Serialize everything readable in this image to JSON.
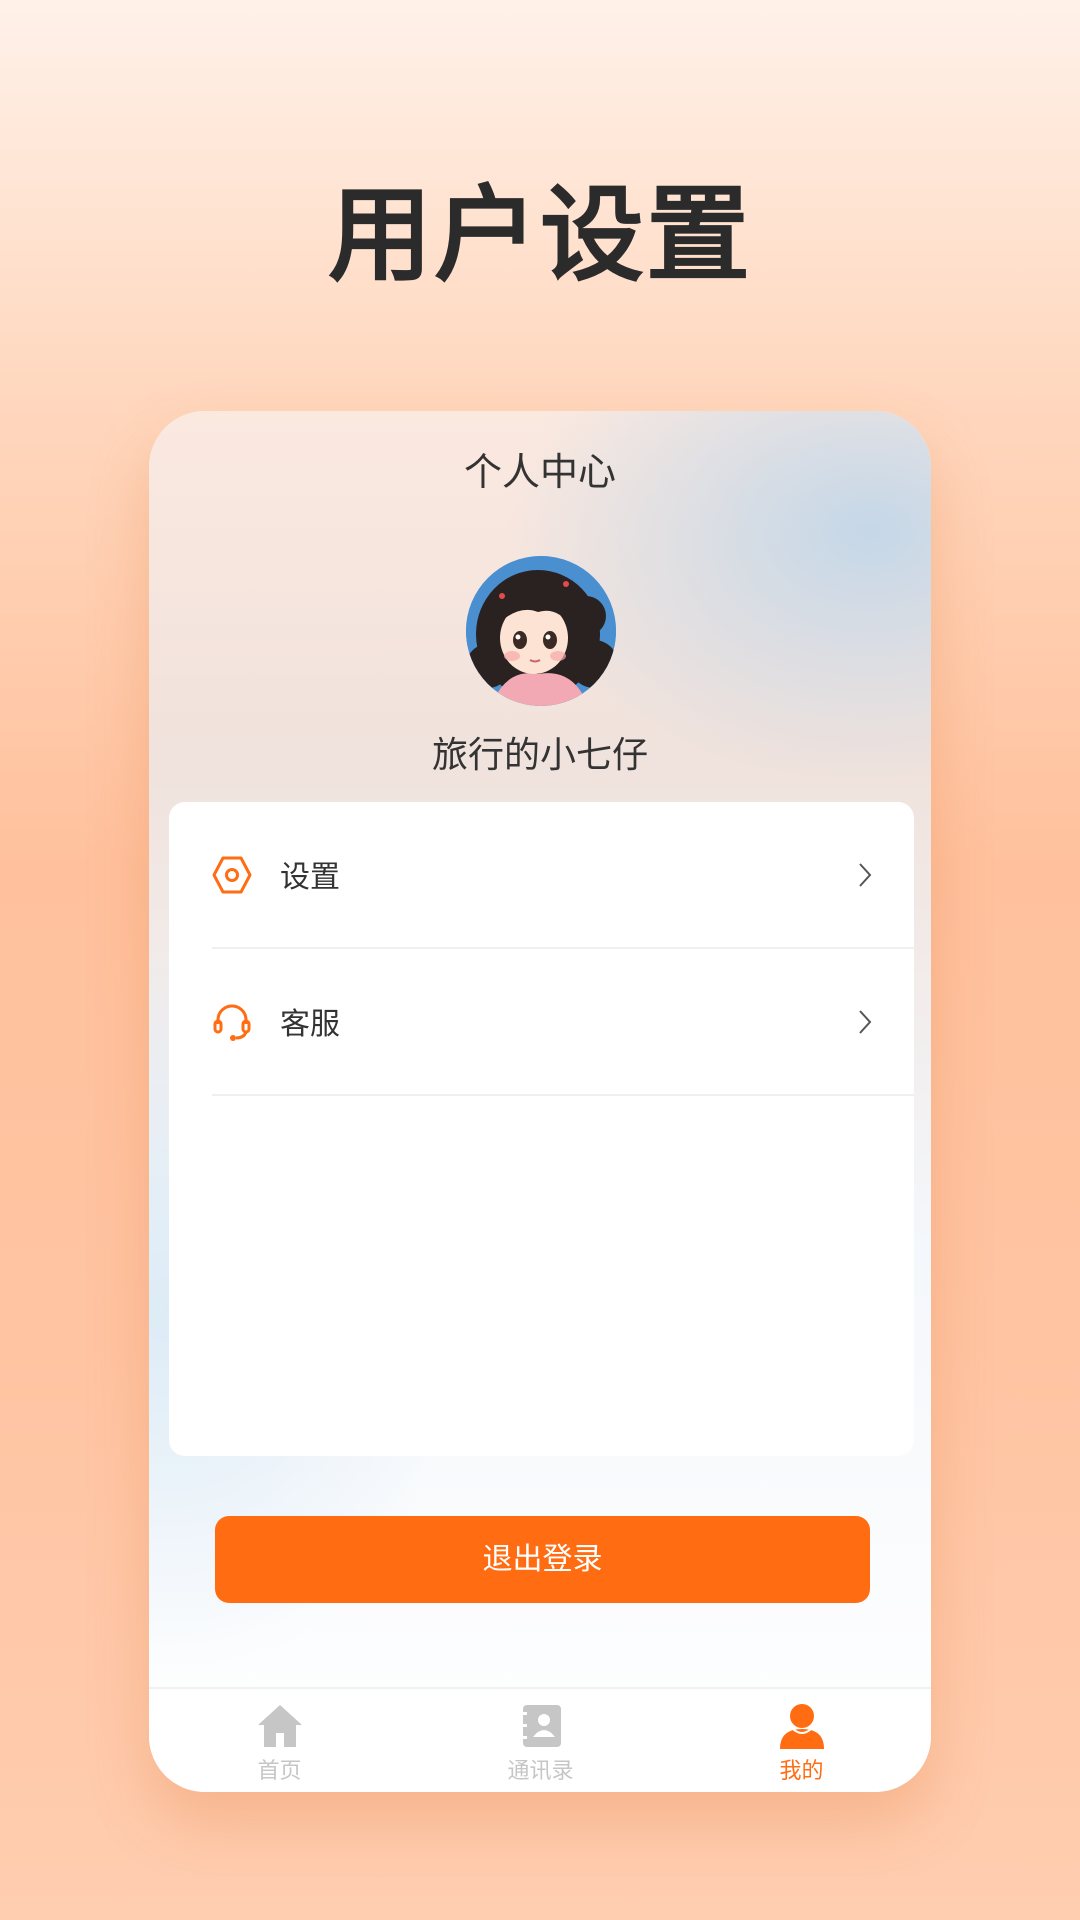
{
  "headline": "用户设置",
  "header": {
    "title": "个人中心"
  },
  "profile": {
    "username": "旅行的小七仔",
    "avatar_icon": "avatar-cartoon-girl"
  },
  "menu": {
    "items": [
      {
        "label": "设置",
        "icon": "settings-hexagon-icon"
      },
      {
        "label": "客服",
        "icon": "headset-icon"
      }
    ]
  },
  "logout": {
    "label": "退出登录"
  },
  "tabbar": {
    "tabs": [
      {
        "label": "首页",
        "icon": "home-icon",
        "active": false
      },
      {
        "label": "通讯录",
        "icon": "contacts-icon",
        "active": false
      },
      {
        "label": "我的",
        "icon": "user-icon",
        "active": true
      }
    ]
  },
  "colors": {
    "accent": "#ff6c12",
    "inactive": "#c6c6c6",
    "text": "#333333"
  }
}
